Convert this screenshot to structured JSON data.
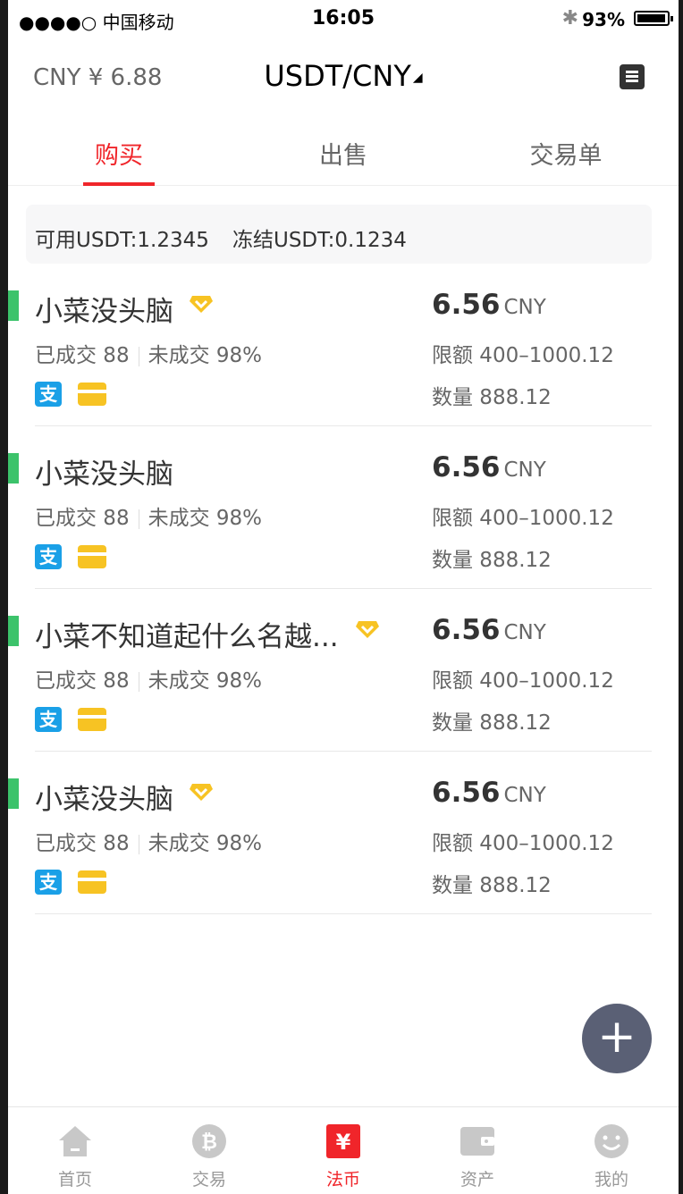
{
  "status_bar": {
    "carrier": "●●●●○ 中国移动",
    "time": "16:05",
    "battery": "93%"
  },
  "header": {
    "currency": "CNY ¥ 6.88",
    "pair": "USDT/CNY",
    "menu_icon": "menu-icon"
  },
  "tabs": [
    {
      "label": "购买",
      "active": true
    },
    {
      "label": "出售",
      "active": false
    },
    {
      "label": "交易单",
      "active": false
    }
  ],
  "balance": {
    "available": "可用USDT:1.2345",
    "frozen": "冻结USDT:0.1234"
  },
  "offers": [
    {
      "name": "小菜没头脑",
      "verified": true,
      "stats_done": "已成交 88",
      "stats_pending": "未成交 98%",
      "price": "6.56",
      "price_unit": "CNY",
      "limit": "限额 400–1000.12",
      "quantity": "数量 888.12"
    },
    {
      "name": "小菜没头脑",
      "verified": false,
      "stats_done": "已成交 88",
      "stats_pending": "未成交 98%",
      "price": "6.56",
      "price_unit": "CNY",
      "limit": "限额 400–1000.12",
      "quantity": "数量 888.12"
    },
    {
      "name": "小菜不知道起什么名越...",
      "verified": true,
      "stats_done": "已成交 88",
      "stats_pending": "未成交 98%",
      "price": "6.56",
      "price_unit": "CNY",
      "limit": "限额 400–1000.12",
      "quantity": "数量 888.12"
    },
    {
      "name": "小菜没头脑",
      "verified": true,
      "stats_done": "已成交 88",
      "stats_pending": "未成交 98%",
      "price": "6.56",
      "price_unit": "CNY",
      "limit": "限额 400–1000.12",
      "quantity": "数量 888.12"
    }
  ],
  "payment": {
    "alipay_glyph": "支"
  },
  "fab_label": "+",
  "bottom_nav": [
    {
      "label": "首页",
      "icon": "home-icon",
      "active": false
    },
    {
      "label": "交易",
      "icon": "bitcoin-icon",
      "active": false
    },
    {
      "label": "法币",
      "icon": "yen-icon",
      "active": true
    },
    {
      "label": "资产",
      "icon": "wallet-icon",
      "active": false
    },
    {
      "label": "我的",
      "icon": "profile-icon",
      "active": false
    }
  ],
  "colors": {
    "accent": "#f0252a",
    "text_primary": "#333333",
    "text_secondary": "#666666",
    "balance_bg": "#f7f7f8",
    "online_bar": "#3cc36b",
    "verified_badge": "#f7c323"
  }
}
